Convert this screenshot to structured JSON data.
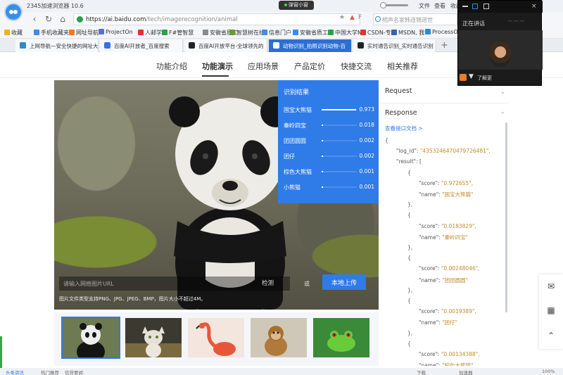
{
  "browser": {
    "title": "2345加速浏览器 10.6",
    "popup_label": "弹窗小窗",
    "menu": [
      "文件",
      "查看",
      "收藏"
    ],
    "address": {
      "host": "https://ai.baidu.com",
      "path": "/tech/imagerecognition/animal"
    },
    "search_placeholder": "相声名家韩连锦逝世",
    "bookmarks": [
      {
        "label": "收藏",
        "color": "#f2b01e"
      },
      {
        "label": "手机收藏夹",
        "color": "#3a8ee6"
      },
      {
        "label": "网址导航",
        "color": "#f07a22"
      },
      {
        "label": "ProjectOn",
        "color": "#5a6fd6"
      },
      {
        "label": "人邮学院",
        "color": "#d33"
      },
      {
        "label": "F#管智慧",
        "color": "#2aa04a"
      },
      {
        "label": "安徽省质工",
        "color": "#8a8a8a"
      },
      {
        "label": "智慧树在线",
        "color": "#6a9a2a"
      },
      {
        "label": "信息门户",
        "color": "#3a8ee6"
      },
      {
        "label": "安徽省质工",
        "color": "#3a8ee6"
      },
      {
        "label": "中国大学M",
        "color": "#2aa04a"
      },
      {
        "label": "CSDN-专",
        "color": "#d33"
      },
      {
        "label": "MSDN, 我",
        "color": "#3a5fb8"
      },
      {
        "label": "ProcessO",
        "color": "#2a8ad6"
      }
    ],
    "tabs": [
      {
        "label": "上网导航—安全快捷的网址大",
        "color": "#2a8ad6",
        "active": false
      },
      {
        "label": "百度AI开放者_百度搜索",
        "color": "#3a6fe6",
        "active": false
      },
      {
        "label": "百度AI开放平台-全球领先的",
        "color": "#222",
        "active": false
      },
      {
        "label": "动物识别_拍照识别动物-百",
        "color": "#222",
        "active": true
      },
      {
        "label": "实时通告识别_实时通告识别",
        "color": "#222",
        "active": false
      }
    ]
  },
  "float_window": {
    "status": "正在讲话",
    "tip": "了解更"
  },
  "page": {
    "tabs": [
      "功能介绍",
      "功能演示",
      "应用场景",
      "产品定价",
      "快捷交流",
      "相关推荐"
    ],
    "active_tab": 1,
    "result": {
      "title": "识别结果",
      "items": [
        {
          "name": "国宝大熊猫",
          "score": "0.973",
          "value": 0.973
        },
        {
          "name": "秦岭四宝",
          "score": "0.018",
          "value": 0.018
        },
        {
          "name": "团团圆圆",
          "score": "0.002",
          "value": 0.002
        },
        {
          "name": "团仔",
          "score": "0.002",
          "value": 0.002
        },
        {
          "name": "棕色大熊猫",
          "score": "0.001",
          "value": 0.001
        },
        {
          "name": "小熊猫",
          "score": "0.001",
          "value": 0.001
        }
      ]
    },
    "url_placeholder": "请输入网络图片URL",
    "detect_label": "检测",
    "or_label": "或",
    "upload_label": "本地上传",
    "format_hint": "图片文件类型支持PNG、JPG、JPEG、BMP，图片大小不超过4M。",
    "thumbnails": [
      "panda",
      "cat",
      "flamingo",
      "monkey",
      "frog"
    ],
    "selected_thumbnail": 0
  },
  "json_panel": {
    "request_label": "Request",
    "response_label": "Response",
    "doc_link": "查看接口文档 >",
    "lines": [
      {
        "indent": 0,
        "text": "{"
      },
      {
        "indent": 1,
        "key": "\"log_id\": ",
        "value": "\"4353246470479726481\","
      },
      {
        "indent": 1,
        "key": "\"result\": [",
        "value": ""
      },
      {
        "indent": 2,
        "text": "{"
      },
      {
        "indent": 3,
        "key": "\"score\": ",
        "value": "\"0.972655\","
      },
      {
        "indent": 3,
        "key": "\"name\": ",
        "value": "\"国宝大熊猫\""
      },
      {
        "indent": 2,
        "text": "},"
      },
      {
        "indent": 2,
        "text": "{"
      },
      {
        "indent": 3,
        "key": "\"score\": ",
        "value": "\"0.0183829\","
      },
      {
        "indent": 3,
        "key": "\"name\": ",
        "value": "\"秦岭四宝\""
      },
      {
        "indent": 2,
        "text": "},"
      },
      {
        "indent": 2,
        "text": "{"
      },
      {
        "indent": 3,
        "key": "\"score\": ",
        "value": "\"0.00248046\","
      },
      {
        "indent": 3,
        "key": "\"name\": ",
        "value": "\"团团圆圆\""
      },
      {
        "indent": 2,
        "text": "},"
      },
      {
        "indent": 2,
        "text": "{"
      },
      {
        "indent": 3,
        "key": "\"score\": ",
        "value": "\"0.0019389\","
      },
      {
        "indent": 3,
        "key": "\"name\": ",
        "value": "\"团仔\""
      },
      {
        "indent": 2,
        "text": "},"
      },
      {
        "indent": 2,
        "text": "{"
      },
      {
        "indent": 3,
        "key": "\"score\": ",
        "value": "\"0.00134388\","
      },
      {
        "indent": 3,
        "key": "\"name\": ",
        "value": "\"棕色大熊猫\""
      }
    ]
  },
  "statusbar": {
    "left": "头条资讯",
    "hot": "热门推荐",
    "news": "信贷要闻",
    "download": "下载",
    "speed": "加速器",
    "zoom": "100%"
  },
  "colors": {
    "accent": "#2f7be8",
    "json_string": "#c38a2b"
  }
}
